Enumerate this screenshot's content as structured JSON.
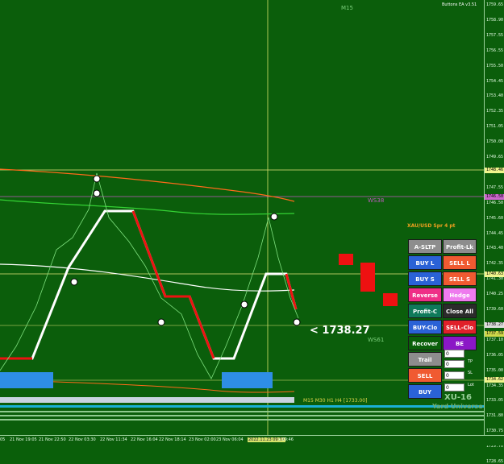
{
  "ea_title": "Buttons EA v3.51",
  "timeframe": "M15",
  "symbol_info": "XAU/USD Spr 4 pt",
  "current_price_label": "< 1738.27",
  "level_labels": {
    "ws38": "WS38",
    "ws61": "WS61"
  },
  "tf_row": "M15 M30 H1 H4  [1733.00]",
  "logo": {
    "main": "XU-16",
    "sub": "Yard Universe"
  },
  "price_axis": [
    "1759.65",
    "1758.90",
    "1757.55",
    "1756.55",
    "1755.50",
    "1754.45",
    "1753.40",
    "1752.35",
    "1751.05",
    "1750.00",
    "1749.65",
    "1748.60",
    "1747.55",
    "1746.50",
    "1745.60",
    "1744.45",
    "1743.40",
    "1742.35",
    "1741.30",
    "1740.25",
    "1739.60",
    "1738.15",
    "1737.10",
    "1736.05",
    "1735.00",
    "1734.35",
    "1733.05",
    "1731.80",
    "1730.75",
    "1729.70",
    "1728.65"
  ],
  "price_boxes": [
    {
      "label": "1748.46",
      "color": "#f0f58c"
    },
    {
      "label": "1746.50",
      "color": "#cc66cc"
    },
    {
      "label": "1740.63",
      "color": "#f0f58c"
    },
    {
      "label": "1738.27",
      "color": "#dddddd"
    },
    {
      "label": "1737.59",
      "color": "#cfd84a"
    },
    {
      "label": "1734.62",
      "color": "#f0f58c"
    }
  ],
  "time_axis": [
    "05",
    "21 Nov 19:05",
    "21 Nov 22:50",
    "22 Nov 03:30",
    "22 Nov 11:34",
    "22 Nov 16:04",
    "22 Nov 18:14",
    "23 Nov 02:00",
    "23 Nov 06:04",
    "2022.11.23 09:37",
    "x 09:46"
  ],
  "buttons": [
    {
      "label": "A-SLTP",
      "color": "#8d8d8d"
    },
    {
      "label": "Profit-Lk",
      "color": "#8d8d8d"
    },
    {
      "label": "BUY L",
      "color": "#2a62d6"
    },
    {
      "label": "SELL L",
      "color": "#f05a31"
    },
    {
      "label": "BUY S",
      "color": "#2a62d6"
    },
    {
      "label": "SELL S",
      "color": "#f05a31"
    },
    {
      "label": "Reverse",
      "color": "#ef2f87"
    },
    {
      "label": "Hedge",
      "color": "#ee7bee"
    },
    {
      "label": "Profit-C",
      "color": "#0f7a5a"
    },
    {
      "label": "Close All",
      "color": "#2b2b2b"
    },
    {
      "label": "BUY-Clo",
      "color": "#2a62d6"
    },
    {
      "label": "SELL-Clo",
      "color": "#e0202a"
    },
    {
      "label": "Recover",
      "color": "#0a5f0a"
    },
    {
      "label": "BE",
      "color": "#8b17c6"
    },
    {
      "label": "Trail",
      "color": "#8d8d8d"
    },
    {
      "label": "SELL",
      "color": "#f05a31"
    },
    {
      "label": "BUY",
      "color": "#2a62d6"
    }
  ],
  "inputs": [
    {
      "value": "0",
      "label": ""
    },
    {
      "value": "0",
      "label": "TP"
    },
    {
      "value": "0",
      "label": "SL"
    },
    {
      "value": "0",
      "label": "Lot"
    }
  ]
}
